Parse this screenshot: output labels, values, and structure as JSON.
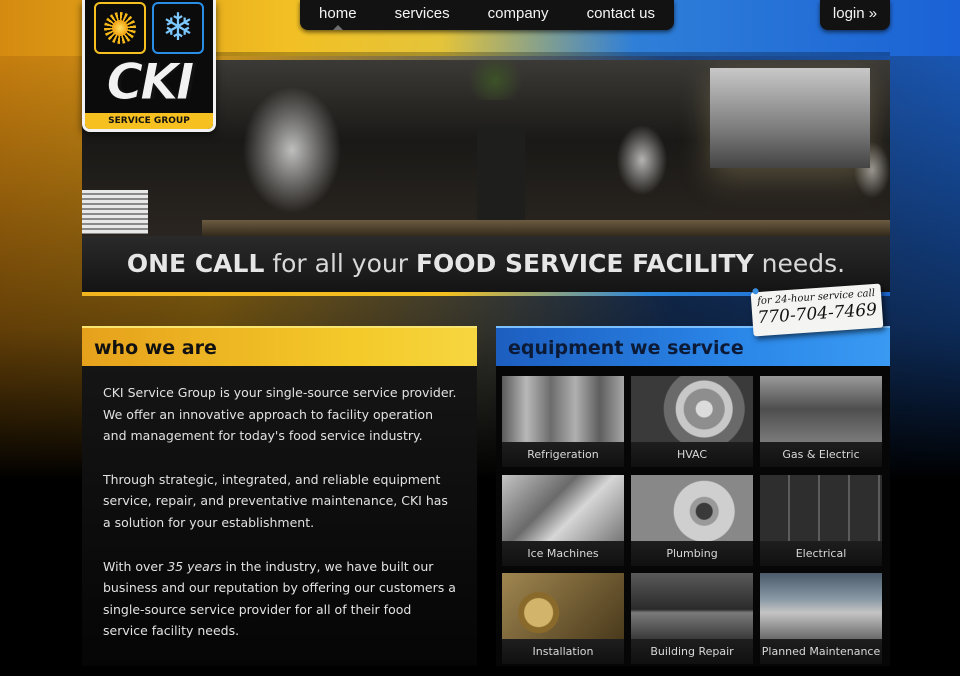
{
  "nav": {
    "items": [
      {
        "label": "home",
        "active": true
      },
      {
        "label": "services",
        "active": false
      },
      {
        "label": "company",
        "active": false
      },
      {
        "label": "contact us",
        "active": false
      }
    ],
    "login_label": "login »"
  },
  "logo": {
    "wordmark": "CKI",
    "subtitle": "SERVICE GROUP",
    "icons": [
      "sun-icon",
      "snowflake-icon"
    ]
  },
  "tagline": {
    "part1": "ONE CALL",
    "part2": " for all your ",
    "part3": "FOOD SERVICE FACILITY",
    "part4": " needs."
  },
  "phone_note": {
    "caption": "for 24-hour service call",
    "number": "770-704-7469"
  },
  "who_we_are": {
    "heading": "who we are",
    "para1": "CKI Service Group is your single-source service provider. We offer an innovative approach to facility operation and management for today's food service industry.",
    "para2": "Through strategic, integrated, and reliable equipment service, repair, and preventative maintenance, CKI has a solution for your establishment.",
    "para3_a": "With over ",
    "para3_em": "35 years",
    "para3_b": " in the industry, we have built our business and our reputation by offering our customers a single-source service provider for all of their food service facility needs."
  },
  "equipment": {
    "heading": "equipment we service",
    "tiles": [
      {
        "label": "Refrigeration"
      },
      {
        "label": "HVAC"
      },
      {
        "label": "Gas & Electric"
      },
      {
        "label": "Ice Machines"
      },
      {
        "label": "Plumbing"
      },
      {
        "label": "Electrical"
      },
      {
        "label": "Installation"
      },
      {
        "label": "Building Repair"
      },
      {
        "label": "Planned Maintenance"
      }
    ]
  },
  "colors": {
    "accent_yellow": "#f4c22a",
    "accent_blue": "#2a86e8",
    "background": "#000000"
  }
}
